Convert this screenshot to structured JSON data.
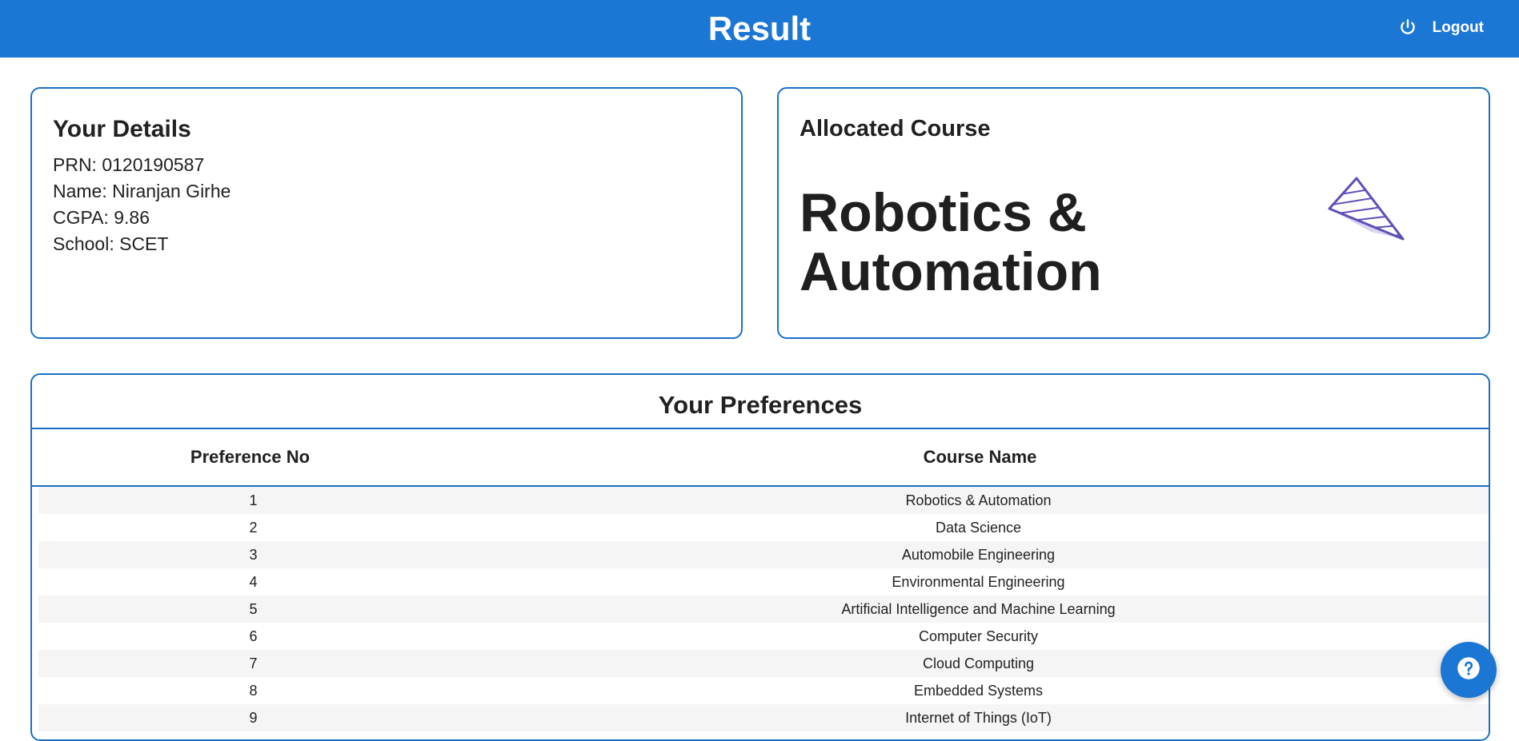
{
  "header": {
    "title": "Result",
    "logout_label": "Logout"
  },
  "details": {
    "heading": "Your Details",
    "prn": "PRN: 0120190587",
    "name": "Name: Niranjan Girhe",
    "cgpa": "CGPA: 9.86",
    "school": "School: SCET"
  },
  "allocated": {
    "heading": "Allocated Course",
    "course": "Robotics & Automation"
  },
  "preferences": {
    "heading": "Your Preferences",
    "columns": [
      "Preference No",
      "Course Name"
    ],
    "rows": [
      [
        "1",
        "Robotics & Automation"
      ],
      [
        "2",
        "Data Science"
      ],
      [
        "3",
        "Automobile Engineering"
      ],
      [
        "4",
        "Environmental Engineering"
      ],
      [
        "5",
        "Artificial Intelligence and Machine Learning"
      ],
      [
        "6",
        "Computer Security"
      ],
      [
        "7",
        "Cloud Computing"
      ],
      [
        "8",
        "Embedded Systems"
      ],
      [
        "9",
        "Internet of Things (IoT)"
      ]
    ]
  },
  "colors": {
    "accent": "#1b77d3",
    "border": "#1b6fc6",
    "illustration": "#5c4fb8"
  }
}
